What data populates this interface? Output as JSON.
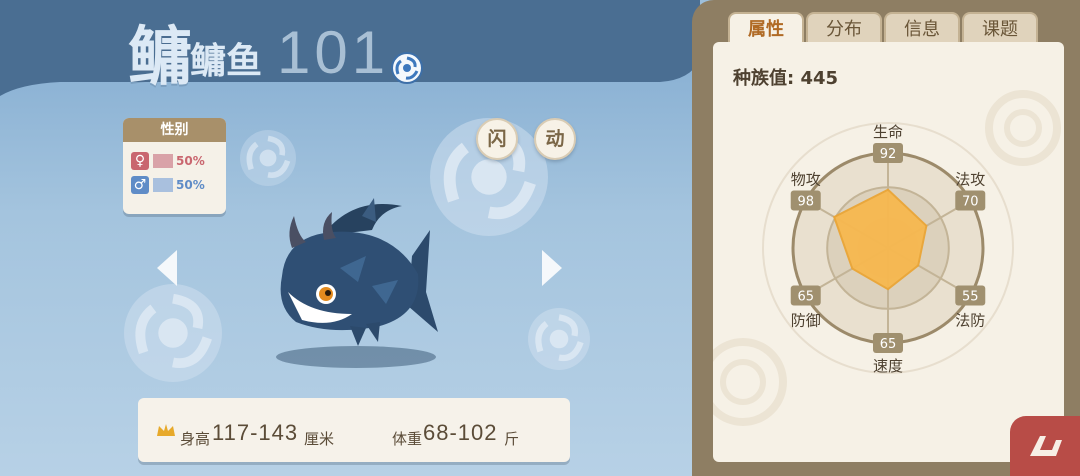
{
  "pet": {
    "name_large": "鳙",
    "name_small": "鳙鱼",
    "number": "101",
    "element_icon": "water-swirl-icon"
  },
  "gender": {
    "title": "性别",
    "female_symbol": "♀",
    "female_pct": "50%",
    "male_symbol": "♂",
    "male_pct": "50%",
    "female_color": "#c9666f",
    "male_color": "#5f8cc7"
  },
  "buttons": {
    "flash_label": "闪",
    "move_label": "动"
  },
  "size": {
    "height_label": "身高",
    "height_value": "117-143",
    "height_unit": "厘米",
    "weight_label": "体重",
    "weight_value": "68-102",
    "weight_unit": "斤"
  },
  "tabs": [
    {
      "label": "属性",
      "active": true
    },
    {
      "label": "分布",
      "active": false
    },
    {
      "label": "信息",
      "active": false
    },
    {
      "label": "课题",
      "active": false
    }
  ],
  "stats": {
    "total_label": "种族值: 445",
    "max_value": 150,
    "fill_color": "#f7b84f",
    "items": [
      {
        "name": "生命",
        "value": 92
      },
      {
        "name": "法攻",
        "value": 70
      },
      {
        "name": "法防",
        "value": 55
      },
      {
        "name": "速度",
        "value": 65
      },
      {
        "name": "防御",
        "value": 65
      },
      {
        "name": "物攻",
        "value": 98
      }
    ]
  },
  "return_icon": "return-arrow-icon"
}
